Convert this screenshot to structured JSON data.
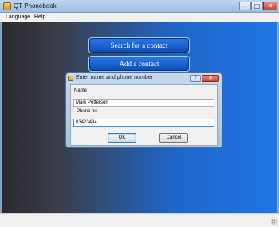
{
  "window": {
    "title": "QT Phonebook",
    "controls": {
      "minimize": "–",
      "maximize": "□",
      "close": "✕"
    }
  },
  "menubar": {
    "items": [
      {
        "label": "Language"
      },
      {
        "label": "Help"
      }
    ]
  },
  "main": {
    "search_button": "Search for a contact",
    "add_button": "Add a contact"
  },
  "dialog": {
    "title": "Enter name and phone number",
    "help_glyph": "?",
    "close_glyph": "✕",
    "name_label": "Name",
    "name_value": "Mark Petterson",
    "phone_label": "Phone nu",
    "phone_value": "03423434",
    "ok_label": "OK",
    "cancel_label": "Cancel"
  },
  "colors": {
    "accent": "#1f75e6",
    "background_left": "#2a2a2e",
    "button": "#0b4db6"
  }
}
